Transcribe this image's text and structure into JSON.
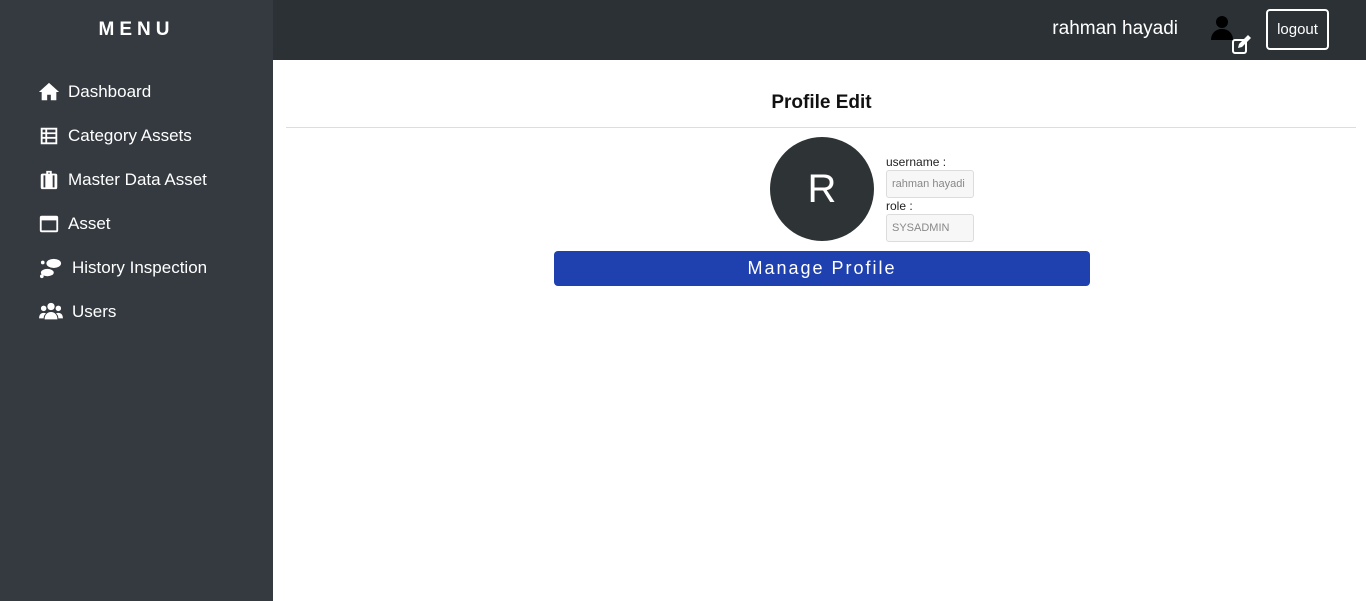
{
  "sidebar": {
    "title": "MENU",
    "items": [
      {
        "label": "Dashboard",
        "icon": "home-icon"
      },
      {
        "label": "Category Assets",
        "icon": "table-list-icon"
      },
      {
        "label": "Master Data Asset",
        "icon": "suitcase-icon"
      },
      {
        "label": "Asset",
        "icon": "window-icon"
      },
      {
        "label": "History Inspection",
        "icon": "footprints-icon"
      },
      {
        "label": "Users",
        "icon": "users-icon"
      }
    ]
  },
  "header": {
    "user_name": "rahman hayadi",
    "logout_label": "logout"
  },
  "main": {
    "title": "Profile Edit",
    "avatar_initial": "R",
    "username_label": "username :",
    "username_value": "rahman hayadi",
    "role_label": "role :",
    "role_value": "SYSADMIN",
    "manage_button_label": "Manage Profile"
  },
  "colors": {
    "sidebar_bg": "#343a40",
    "header_bg": "#2b3135",
    "primary_button": "#1f40af",
    "avatar_bg": "#2e3436"
  }
}
